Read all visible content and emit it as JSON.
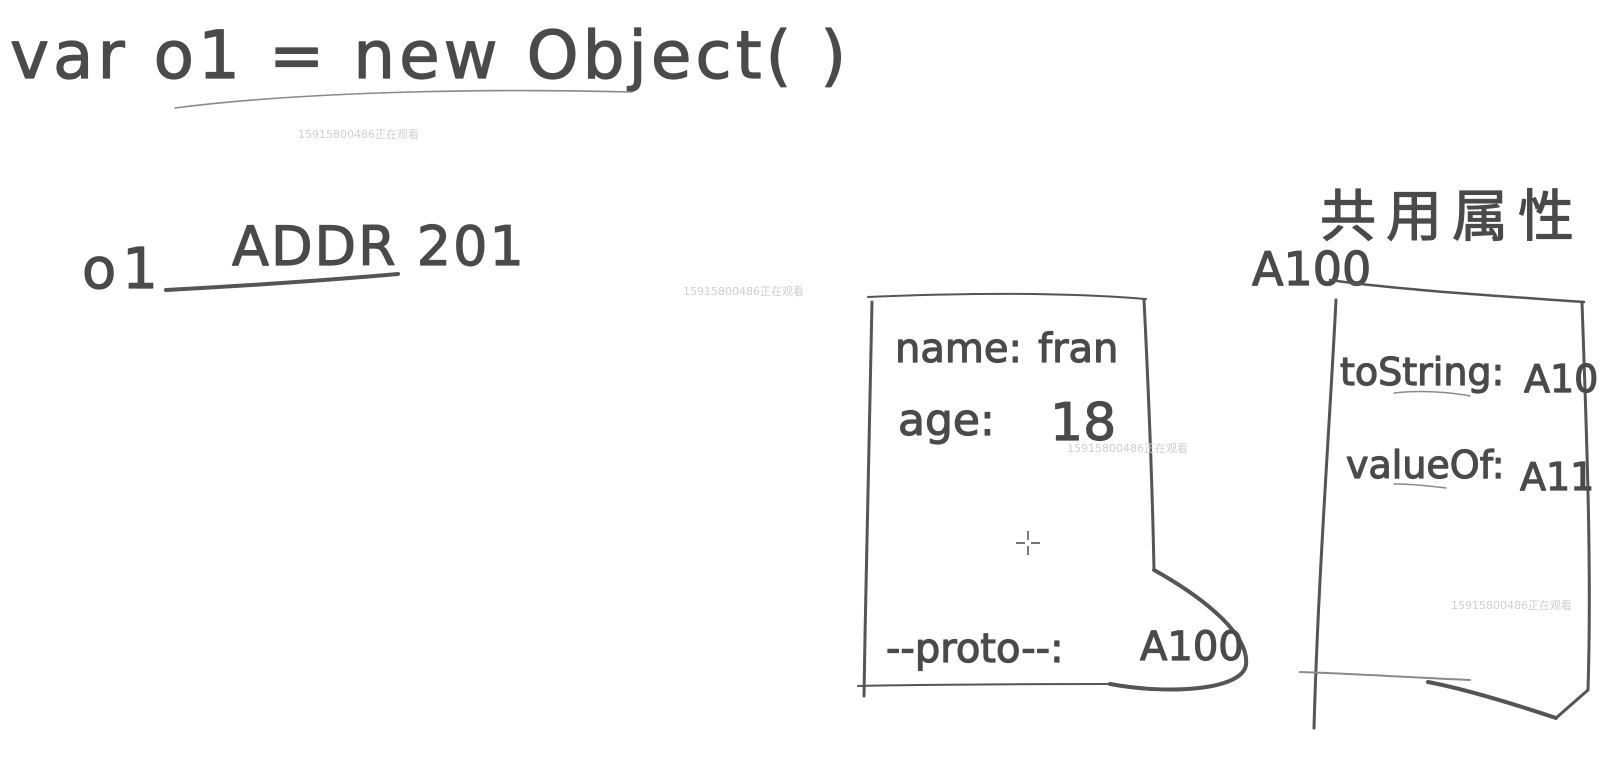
{
  "code_line": {
    "text": "var o1 = new Object( )"
  },
  "reference": {
    "variable": "o1",
    "address": "ADDR 201"
  },
  "instance_object": {
    "fields": [
      {
        "key": "name:",
        "value": "fran"
      },
      {
        "key": "age:",
        "value": "18"
      }
    ],
    "proto_label": "--proto--:",
    "proto_value": "A100"
  },
  "prototype_object": {
    "address": "A100",
    "title": "共用属性",
    "fields": [
      {
        "key": "toString:",
        "value": "A10"
      },
      {
        "key": "valueOf:",
        "value": "A11"
      }
    ]
  },
  "watermarks": [
    "15915800486正在观看",
    "15915800486正在观看",
    "15915800486正在观看",
    "15915800486正在观看"
  ],
  "colors": {
    "ink": "#4a4a4a",
    "background": "#ffffff",
    "watermark": "#cfcfcf"
  }
}
